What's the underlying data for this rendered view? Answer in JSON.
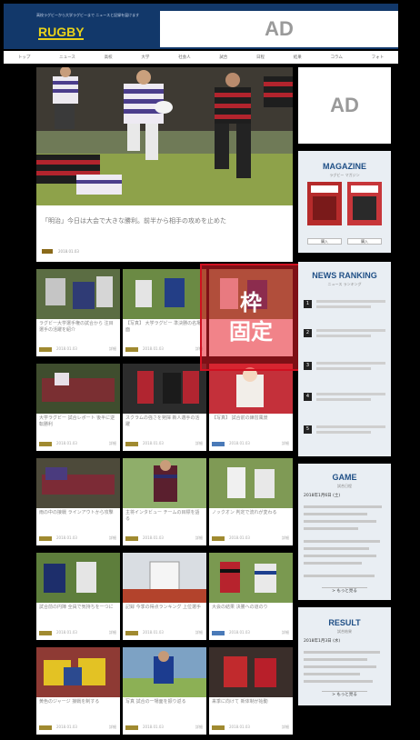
{
  "header": {
    "tagline": "高校ラグビーから大学ラグビーまで ニュースと記録を届けます",
    "logo_text": "RUGBY",
    "ad_label": "AD"
  },
  "nav": {
    "items": [
      "トップ",
      "ニュース",
      "高校",
      "大学",
      "社会人",
      "試合",
      "日程",
      "結果",
      "コラム",
      "フォト"
    ]
  },
  "hero": {
    "title": "「明治」今日は大会で大きな勝利。前半から相手の攻めを止めた",
    "category": "大学",
    "date": "2018.01.03"
  },
  "cards": [
    {
      "title": "ラグビー大学選手権の試合から 注目選手の活躍を紹介",
      "date": "2018.01.03",
      "more": "詳細"
    },
    {
      "title": "【写真】 大学ラグビー 準決勝の名場面",
      "date": "2018.01.03",
      "more": "詳細"
    },
    {
      "title": "",
      "date": "",
      "more": ""
    },
    {
      "title": "大学ラグビー 試合レポート 後半に逆転勝利",
      "date": "2018.01.03",
      "more": "詳細"
    },
    {
      "title": "スクラムの強さを発揮 新人選手の活躍",
      "date": "2018.01.03",
      "more": "詳細"
    },
    {
      "title": "【写真】 試合前の練習風景",
      "date": "2018.01.03",
      "more": "詳細"
    },
    {
      "title": "雨の中の接戦 ラインアウトから攻撃",
      "date": "2018.01.03",
      "more": "詳細"
    },
    {
      "title": "主将インタビュー チームの目標を語る",
      "date": "2018.01.03",
      "more": "詳細"
    },
    {
      "title": "ノックオン 判定で流れが変わる",
      "date": "2018.01.03",
      "more": "詳細"
    },
    {
      "title": "試合前の円陣 全員で気持ちを一つに",
      "date": "2018.01.03",
      "more": "詳細"
    },
    {
      "title": "記録 今季の得点ランキング 上位選手",
      "date": "2018.01.03",
      "more": "詳細"
    },
    {
      "title": "大会の結果 決勝への道のり",
      "date": "2018.01.03",
      "more": "詳細"
    },
    {
      "title": "黄色のジャージ 接戦を制する",
      "date": "2018.01.03",
      "more": "詳細"
    },
    {
      "title": "写真 試合の一場面を振り返る",
      "date": "2018.01.03",
      "more": "詳細"
    },
    {
      "title": "来季に向けて 新体制が始動",
      "date": "2018.01.03",
      "more": "詳細"
    }
  ],
  "fixed_label": [
    "枠",
    "固定"
  ],
  "side_ad": "AD",
  "magazine": {
    "title": "MAGAZINE",
    "subtitle": "ラグビー マガジン",
    "buttons": [
      "購入",
      "購入"
    ]
  },
  "ranking": {
    "title": "NEWS RANKING",
    "subtitle": "ニュース ランキング",
    "numbers": [
      "1",
      "2",
      "3",
      "4",
      "5"
    ]
  },
  "game": {
    "title": "GAME",
    "subtitle": "試合日程",
    "date": "2018年1月6日 (土)",
    "more": "> もっと見る"
  },
  "result": {
    "title": "RESULT",
    "subtitle": "試合結果",
    "date": "2018年1月3日 (水)",
    "more": "> もっと見る"
  },
  "colors": {
    "navy": "#12386a",
    "brand_blue": "#1f4f86",
    "fixed_red": "#d01020"
  }
}
